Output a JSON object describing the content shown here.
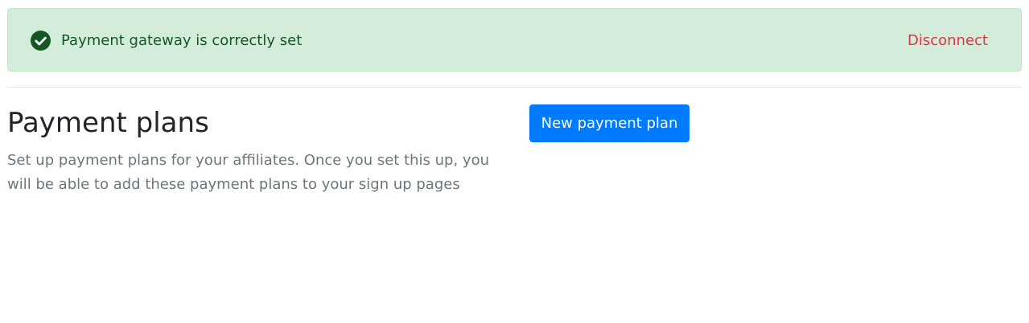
{
  "alert": {
    "icon": "check-circle-icon",
    "message": "Payment gateway is correctly set",
    "action_label": "Disconnect",
    "colors": {
      "background": "#d4edda",
      "text": "#155724",
      "icon": "#155724",
      "action": "#dc3545"
    }
  },
  "payment_plans": {
    "title": "Payment plans",
    "description": "Set up payment plans for your affiliates. Once you set this up, you will be able to add these payment plans to your sign up pages",
    "new_button_label": "New payment plan",
    "button_color": "#007bff"
  }
}
